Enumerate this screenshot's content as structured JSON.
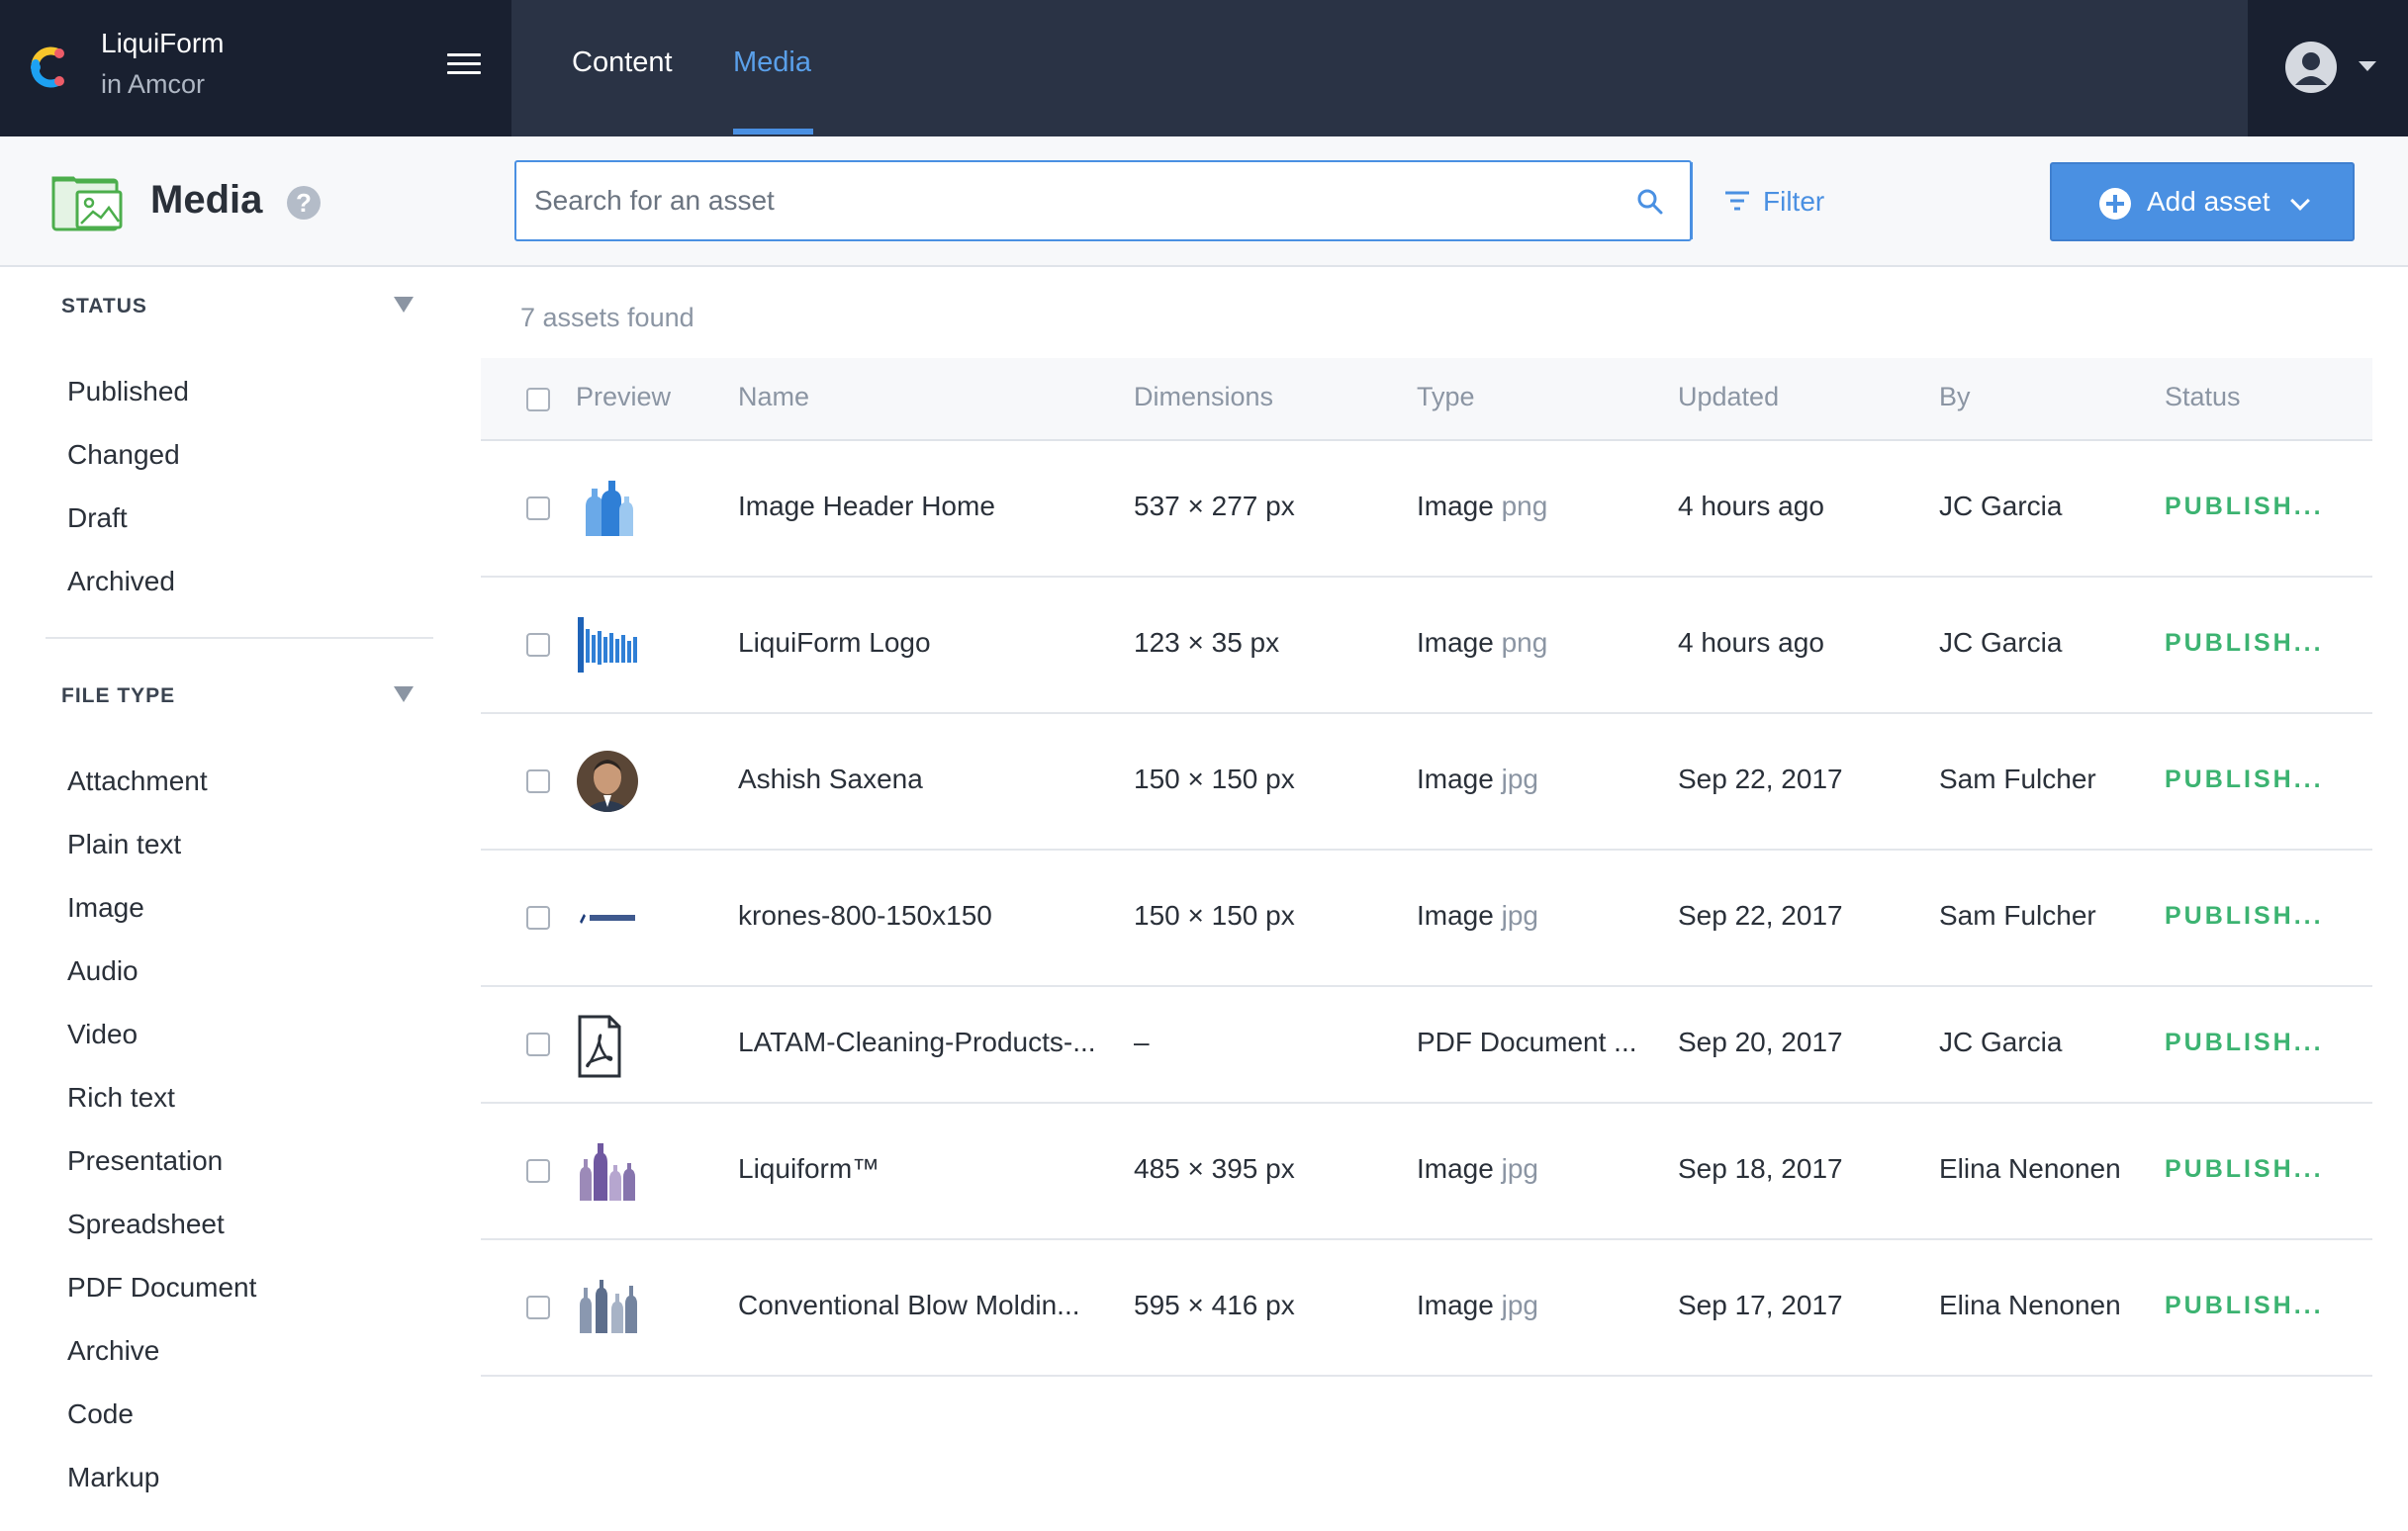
{
  "app": {
    "org_name": "LiquiForm",
    "org_sub": "in Amcor",
    "nav": [
      {
        "label": "Content",
        "active": false
      },
      {
        "label": "Media",
        "active": true
      }
    ]
  },
  "header": {
    "title": "Media",
    "help_glyph": "?",
    "search_placeholder": "Search for an asset",
    "filter_label": "Filter",
    "add_label": "Add asset"
  },
  "sidebar": {
    "status_title": "STATUS",
    "status_items": [
      "Published",
      "Changed",
      "Draft",
      "Archived"
    ],
    "filetype_title": "FILE TYPE",
    "filetype_items": [
      "Attachment",
      "Plain text",
      "Image",
      "Audio",
      "Video",
      "Rich text",
      "Presentation",
      "Spreadsheet",
      "PDF Document",
      "Archive",
      "Code",
      "Markup"
    ]
  },
  "results": {
    "count_label": "7 assets found",
    "columns": [
      "Preview",
      "Name",
      "Dimensions",
      "Type",
      "Updated",
      "By",
      "Status"
    ],
    "rows": [
      {
        "preview": "bottles-blue-thumb",
        "name": "Image Header Home",
        "dimensions": "537 × 277 px",
        "type": "Image",
        "ext": "png",
        "updated": "4 hours ago",
        "by": "JC Garcia",
        "status": "PUBLISH..."
      },
      {
        "preview": "logo-thumb",
        "name": "LiquiForm Logo",
        "dimensions": "123 × 35 px",
        "type": "Image",
        "ext": "png",
        "updated": "4 hours ago",
        "by": "JC Garcia",
        "status": "PUBLISH..."
      },
      {
        "preview": "portrait-thumb",
        "name": "Ashish Saxena",
        "dimensions": "150 × 150 px",
        "type": "Image",
        "ext": "jpg",
        "updated": "Sep 22, 2017",
        "by": "Sam Fulcher",
        "status": "PUBLISH..."
      },
      {
        "preview": "krones-thumb",
        "name": "krones-800-150x150",
        "dimensions": "150 × 150 px",
        "type": "Image",
        "ext": "jpg",
        "updated": "Sep 22, 2017",
        "by": "Sam Fulcher",
        "status": "PUBLISH..."
      },
      {
        "preview": "pdf-icon",
        "name": "LATAM-Cleaning-Products-...",
        "dimensions": "–",
        "type": "PDF Document ...",
        "ext": "",
        "updated": "Sep 20, 2017",
        "by": "JC Garcia",
        "status": "PUBLISH..."
      },
      {
        "preview": "bottles-purple-thumb",
        "name": "Liquiform™",
        "dimensions": "485 × 395 px",
        "type": "Image",
        "ext": "jpg",
        "updated": "Sep 18, 2017",
        "by": "Elina Nenonen",
        "status": "PUBLISH..."
      },
      {
        "preview": "molding-thumb",
        "name": "Conventional Blow Moldin...",
        "dimensions": "595 × 416 px",
        "type": "Image",
        "ext": "jpg",
        "updated": "Sep 17, 2017",
        "by": "Elina Nenonen",
        "status": "PUBLISH..."
      }
    ]
  },
  "colors": {
    "topbar": "#2a3345",
    "accent": "#4a90e2",
    "published": "#3cb371"
  }
}
